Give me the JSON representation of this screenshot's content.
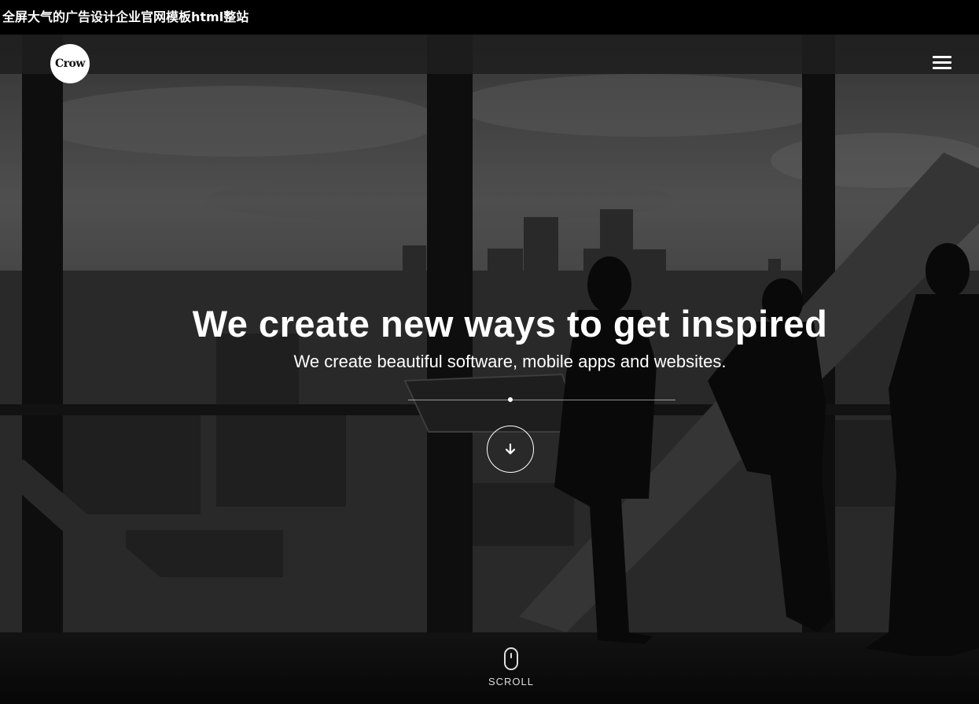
{
  "page_title": "全屏大气的广告设计企业官网模板html整站",
  "logo": {
    "text": "Crow"
  },
  "nav": {
    "menu_icon": "hamburger-menu-icon"
  },
  "hero": {
    "headline": "We create new ways to get inspired",
    "subheadline": "We create beautiful software, mobile apps and websites.",
    "down_icon": "arrow-down-icon",
    "scroll_icon": "mouse-icon",
    "scroll_label": "SCROLL"
  },
  "colors": {
    "topbar": "#000000",
    "text": "#ffffff",
    "overlay": "#2b2b2b"
  }
}
